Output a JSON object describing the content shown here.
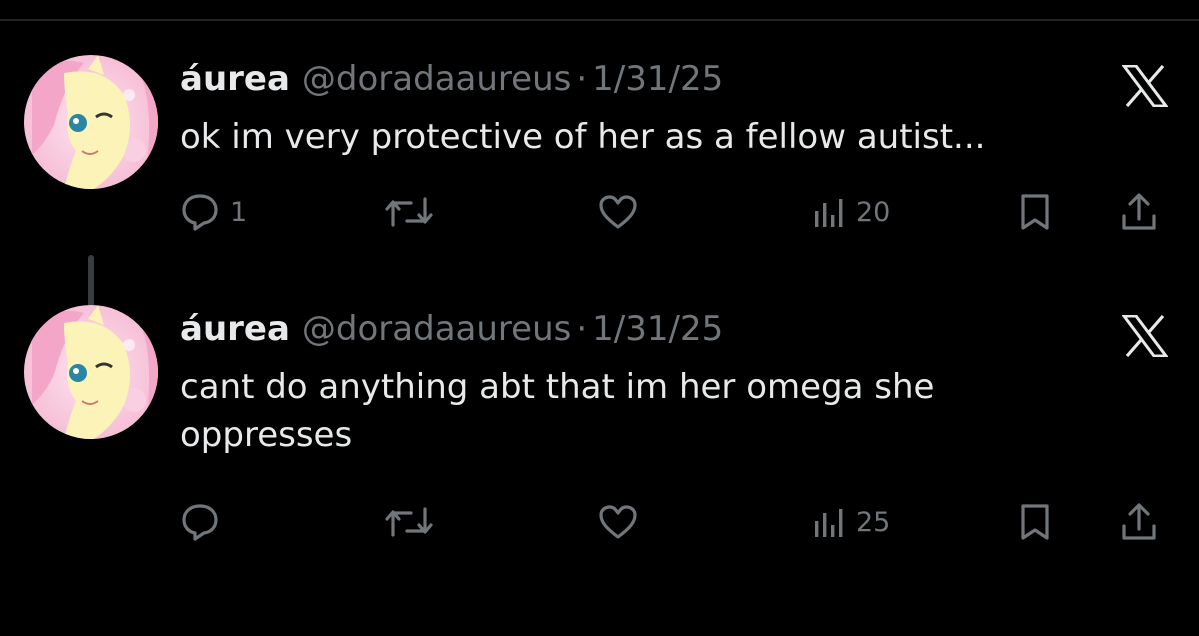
{
  "tweets": [
    {
      "author_name": "áurea",
      "handle": "@doradaaureus",
      "separator": "·",
      "date": "1/31/25",
      "text": "ok im very protective of her as a fellow autist...",
      "reply_count": "1",
      "retweet_count": "",
      "like_count": "",
      "view_count": "20"
    },
    {
      "author_name": "áurea",
      "handle": "@doradaaureus",
      "separator": "·",
      "date": "1/31/25",
      "text": "cant do anything abt that im her omega she oppresses",
      "reply_count": "",
      "retweet_count": "",
      "like_count": "",
      "view_count": "25"
    }
  ],
  "icons": {
    "reply": "reply-icon",
    "retweet": "retweet-icon",
    "like": "heart-icon",
    "views": "views-icon",
    "bookmark": "bookmark-icon",
    "share": "share-icon",
    "platform": "x-logo-icon"
  },
  "colors": {
    "background": "#000000",
    "text_primary": "#e7e9ea",
    "text_secondary": "#71767b",
    "thread_line": "#3a3d40"
  }
}
